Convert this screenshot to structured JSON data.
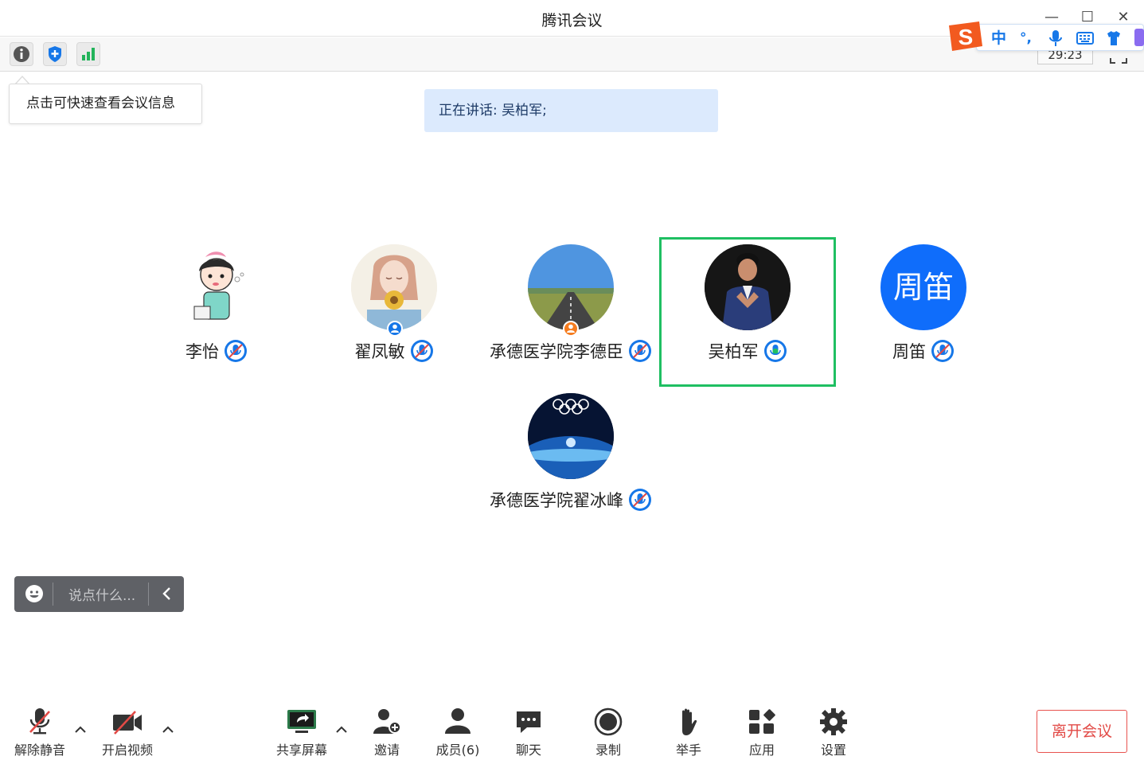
{
  "window": {
    "title": "腾讯会议",
    "minimize_glyph": "—",
    "maximize_glyph": "☐",
    "close_glyph": "✕"
  },
  "ime": {
    "logo": "S",
    "mode": "中",
    "punct": "°,",
    "icons": [
      "mic-icon",
      "keyboard-icon",
      "skin-icon"
    ]
  },
  "toolbar": {
    "icons": [
      "info-icon",
      "shield-icon",
      "signal-icon"
    ],
    "timer": "29:23"
  },
  "tooltip": {
    "text": "点击可快速查看会议信息"
  },
  "speaking_banner": {
    "text": "正在讲话: 吴柏军;"
  },
  "participants": [
    {
      "name": "李怡",
      "avatar": "cartoon-girl",
      "muted": true,
      "speaking": false
    },
    {
      "name": "翟凤敏",
      "avatar": "photo-girl-flower",
      "muted": true,
      "speaking": false,
      "role": "host"
    },
    {
      "name": "承德医学院李德臣",
      "avatar": "road-landscape",
      "muted": true,
      "speaking": false,
      "role": "cohost"
    },
    {
      "name": "吴柏军",
      "avatar": "man-suit",
      "muted": false,
      "speaking": true
    },
    {
      "name": "周笛",
      "avatar_text": "周笛",
      "muted": true,
      "speaking": false
    },
    {
      "name": "承德医学院翟冰峰",
      "avatar": "olympic-earth",
      "muted": true,
      "speaking": false
    }
  ],
  "chat": {
    "placeholder": "说点什么..."
  },
  "bottom_bar": {
    "unmute": "解除静音",
    "video": "开启视频",
    "share": "共享屏幕",
    "invite": "邀请",
    "members": "成员(6)",
    "chat": "聊天",
    "record": "录制",
    "raise_hand": "举手",
    "apps": "应用",
    "settings": "设置",
    "leave": "离开会议"
  },
  "colors": {
    "accent_blue": "#1677e8",
    "speaking_green": "#1fbf62",
    "leave_red": "#e24a46",
    "banner_bg": "#dceafd"
  }
}
